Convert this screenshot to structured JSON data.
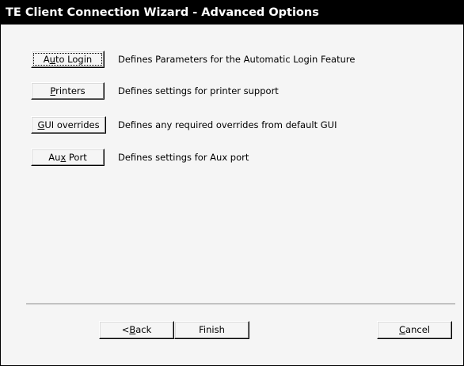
{
  "window": {
    "title": "TE Client Connection Wizard - Advanced Options"
  },
  "options": [
    {
      "label_pre": "A",
      "label_u": "u",
      "label_post": "to Login",
      "description": "Defines Parameters for the Automatic Login Feature"
    },
    {
      "label_pre": "",
      "label_u": "P",
      "label_post": "rinters",
      "description": "Defines settings for printer support"
    },
    {
      "label_pre": "",
      "label_u": "G",
      "label_post": "UI overrides",
      "description": "Defines any required overrides from default GUI"
    },
    {
      "label_pre": "Au",
      "label_u": "x",
      "label_post": " Port",
      "description": "Defines settings for Aux port"
    }
  ],
  "footer": {
    "back": {
      "pre": "<",
      "u": "B",
      "post": "ack"
    },
    "finish": {
      "label": "Finish"
    },
    "cancel": {
      "pre": "",
      "u": "C",
      "post": "ancel"
    }
  }
}
